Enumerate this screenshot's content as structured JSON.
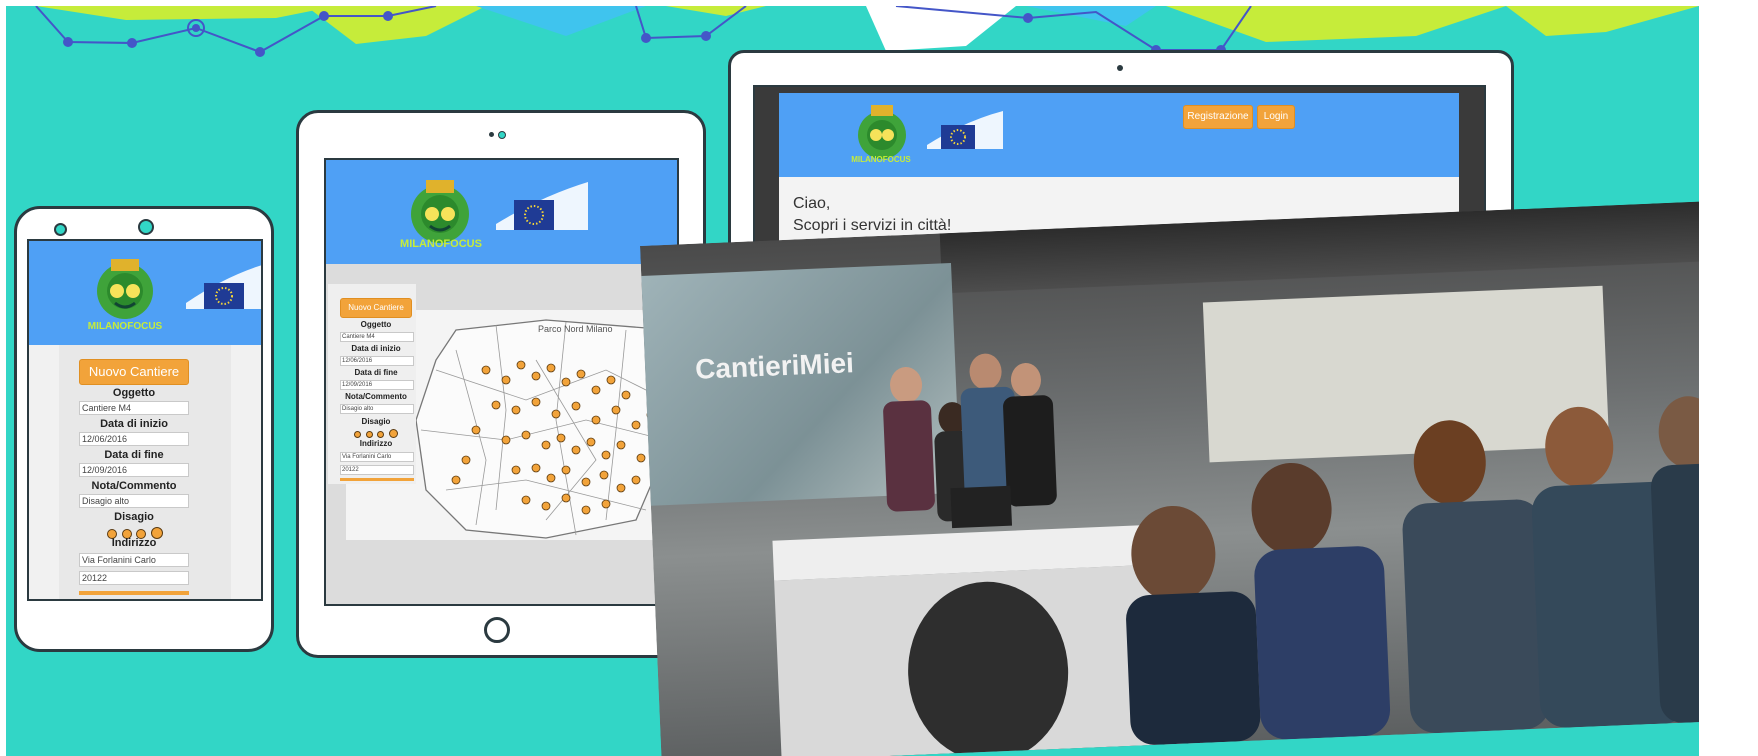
{
  "brand": {
    "logo_text": "MILANOFOCUS",
    "project_name": "CantieriMiei"
  },
  "phone": {
    "new_button": "Nuovo Cantiere",
    "fields": [
      {
        "label": "Oggetto",
        "value": "Cantiere M4"
      },
      {
        "label": "Data di inizio",
        "value": "12/06/2016"
      },
      {
        "label": "Data di fine",
        "value": "12/09/2016"
      },
      {
        "label": "Nota/Commento",
        "value": "Disagio alto"
      }
    ],
    "disagio_label": "Disagio",
    "indirizzo_label": "Indirizzo",
    "address_values": [
      "Via Forlanini Carlo",
      "20122"
    ]
  },
  "tablet": {
    "new_button": "Nuovo Cantiere",
    "fields": [
      {
        "label": "Oggetto",
        "value": "Cantiere M4"
      },
      {
        "label": "Data di inizio",
        "value": "12/06/2016"
      },
      {
        "label": "Data di fine",
        "value": "12/09/2016"
      },
      {
        "label": "Nota/Commento",
        "value": "Disagio alto"
      }
    ],
    "disagio_label": "Disagio",
    "indirizzo_label": "Indirizzo",
    "address_values": [
      "Via Forlanini Carlo",
      "20122"
    ],
    "map_label": "Parco Nord Milano"
  },
  "laptop": {
    "nav": {
      "register": "Registrazione",
      "login": "Login"
    },
    "greeting": "Ciao,",
    "subtitle": "Scopri i servizi in città!"
  },
  "colors": {
    "background": "#32d6c6",
    "header_blue": "#4fa0f5",
    "accent_orange": "#f2a33a"
  }
}
